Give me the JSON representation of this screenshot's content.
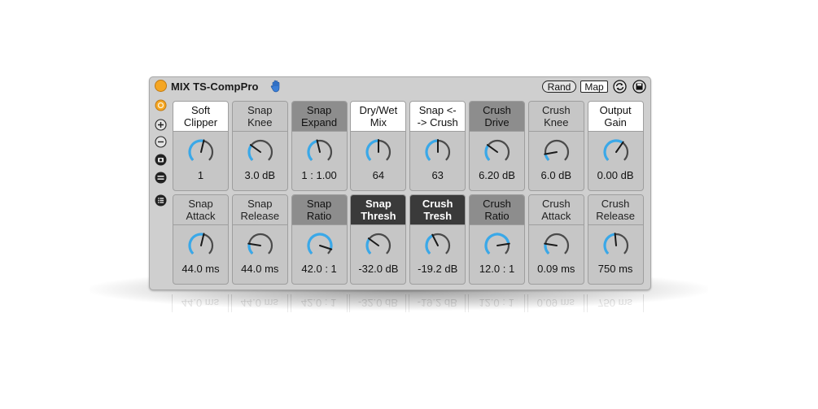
{
  "device": {
    "title": "MIX TS-CompPro",
    "rand_label": "Rand",
    "map_label": "Map"
  },
  "colors": {
    "accent": "#3aa8e8",
    "power": "#f5a623",
    "dark_label": "#3a3a3a",
    "mid_label": "#8d8d8d"
  },
  "icons": {
    "hand": "hand-icon",
    "hot_swap": "hot-swap-icon",
    "save": "save-preset-icon",
    "sidebar": [
      "power-ring-icon",
      "plus-icon",
      "minus-icon",
      "camera-icon",
      "equals-icon",
      "list-icon"
    ]
  },
  "params": [
    {
      "label": "Soft\nClipper",
      "value": "1",
      "style": "white",
      "level": 0.55
    },
    {
      "label": "Snap\nKnee",
      "value": "3.0 dB",
      "style": "grey",
      "level": 0.3
    },
    {
      "label": "Snap\nExpand",
      "value": "1 : 1.00",
      "style": "midgrey",
      "level": 0.45
    },
    {
      "label": "Dry/Wet\nMix",
      "value": "64",
      "style": "white",
      "level": 0.5
    },
    {
      "label": "Snap <-\n-> Crush",
      "value": "63",
      "style": "white",
      "level": 0.5
    },
    {
      "label": "Crush\nDrive",
      "value": "6.20 dB",
      "style": "midgrey",
      "level": 0.3
    },
    {
      "label": "Crush\nKnee",
      "value": "6.0 dB",
      "style": "grey",
      "level": 0.13
    },
    {
      "label": "Output\nGain",
      "value": "0.00 dB",
      "style": "white",
      "level": 0.63
    },
    {
      "label": "Snap\nAttack",
      "value": "44.0 ms",
      "style": "grey",
      "level": 0.55
    },
    {
      "label": "Snap\nRelease",
      "value": "44.0 ms",
      "style": "grey",
      "level": 0.2
    },
    {
      "label": "Snap\nRatio",
      "value": "42.0 : 1",
      "style": "midgrey",
      "level": 0.9
    },
    {
      "label": "Snap\nThresh",
      "value": "-32.0 dB",
      "style": "dark",
      "level": 0.3
    },
    {
      "label": "Crush\nTresh",
      "value": "-19.2 dB",
      "style": "dark",
      "level": 0.4
    },
    {
      "label": "Crush\nRatio",
      "value": "12.0 : 1",
      "style": "midgrey",
      "level": 0.8
    },
    {
      "label": "Crush\nAttack",
      "value": "0.09 ms",
      "style": "grey",
      "level": 0.2
    },
    {
      "label": "Crush\nRelease",
      "value": "750 ms",
      "style": "grey",
      "level": 0.48
    }
  ]
}
